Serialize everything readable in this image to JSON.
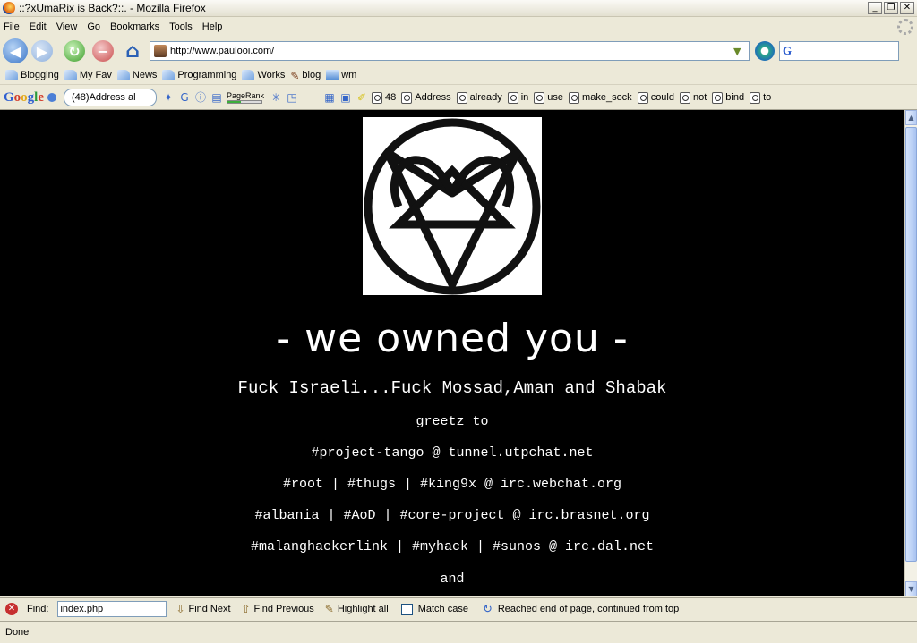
{
  "window": {
    "title": "::?xUmaRix is Back?::. - Mozilla Firefox",
    "minimize": "_",
    "restore": "❐",
    "close": "✕"
  },
  "menu": [
    "File",
    "Edit",
    "View",
    "Go",
    "Bookmarks",
    "Tools",
    "Help"
  ],
  "nav": {
    "url": "http://www.paulooi.com/",
    "search_value": ""
  },
  "bookmarks": [
    {
      "label": "Blogging",
      "icon": "folder-icon"
    },
    {
      "label": "My Fav",
      "icon": "folder-icon"
    },
    {
      "label": "News",
      "icon": "folder-icon"
    },
    {
      "label": "Programming",
      "icon": "folder-icon"
    },
    {
      "label": "Works",
      "icon": "folder-icon"
    },
    {
      "label": "blog",
      "icon": "blog-icon"
    },
    {
      "label": "wm",
      "icon": "mail-icon"
    }
  ],
  "google_toolbar": {
    "logo": [
      "G",
      "o",
      "o",
      "g",
      "l",
      "e"
    ],
    "search_value": "(48)Address al",
    "pagerank_label": "PageRank",
    "terms": [
      "48",
      "Address",
      "already",
      "in",
      "use",
      "make_sock",
      "could",
      "not",
      "bind",
      "to"
    ]
  },
  "content": {
    "headline": "- we owned you -",
    "subline": "Fuck Israeli...Fuck Mossad,Aman and Shabak",
    "lines": [
      "greetz to",
      "#project-tango @ tunnel.utpchat.net",
      "#root | #thugs | #king9x @ irc.webchat.org",
      "#albania | #AoD | #core-project @ irc.brasnet.org",
      "#malanghackerlink | #myhack | #sunos @ irc.dal.net",
      "and"
    ]
  },
  "find": {
    "label": "Find:",
    "value": "index.php",
    "next": "Find Next",
    "previous": "Find Previous",
    "highlight": "Highlight all",
    "match_case": "Match case",
    "status": "Reached end of page, continued from top"
  },
  "status": "Done"
}
